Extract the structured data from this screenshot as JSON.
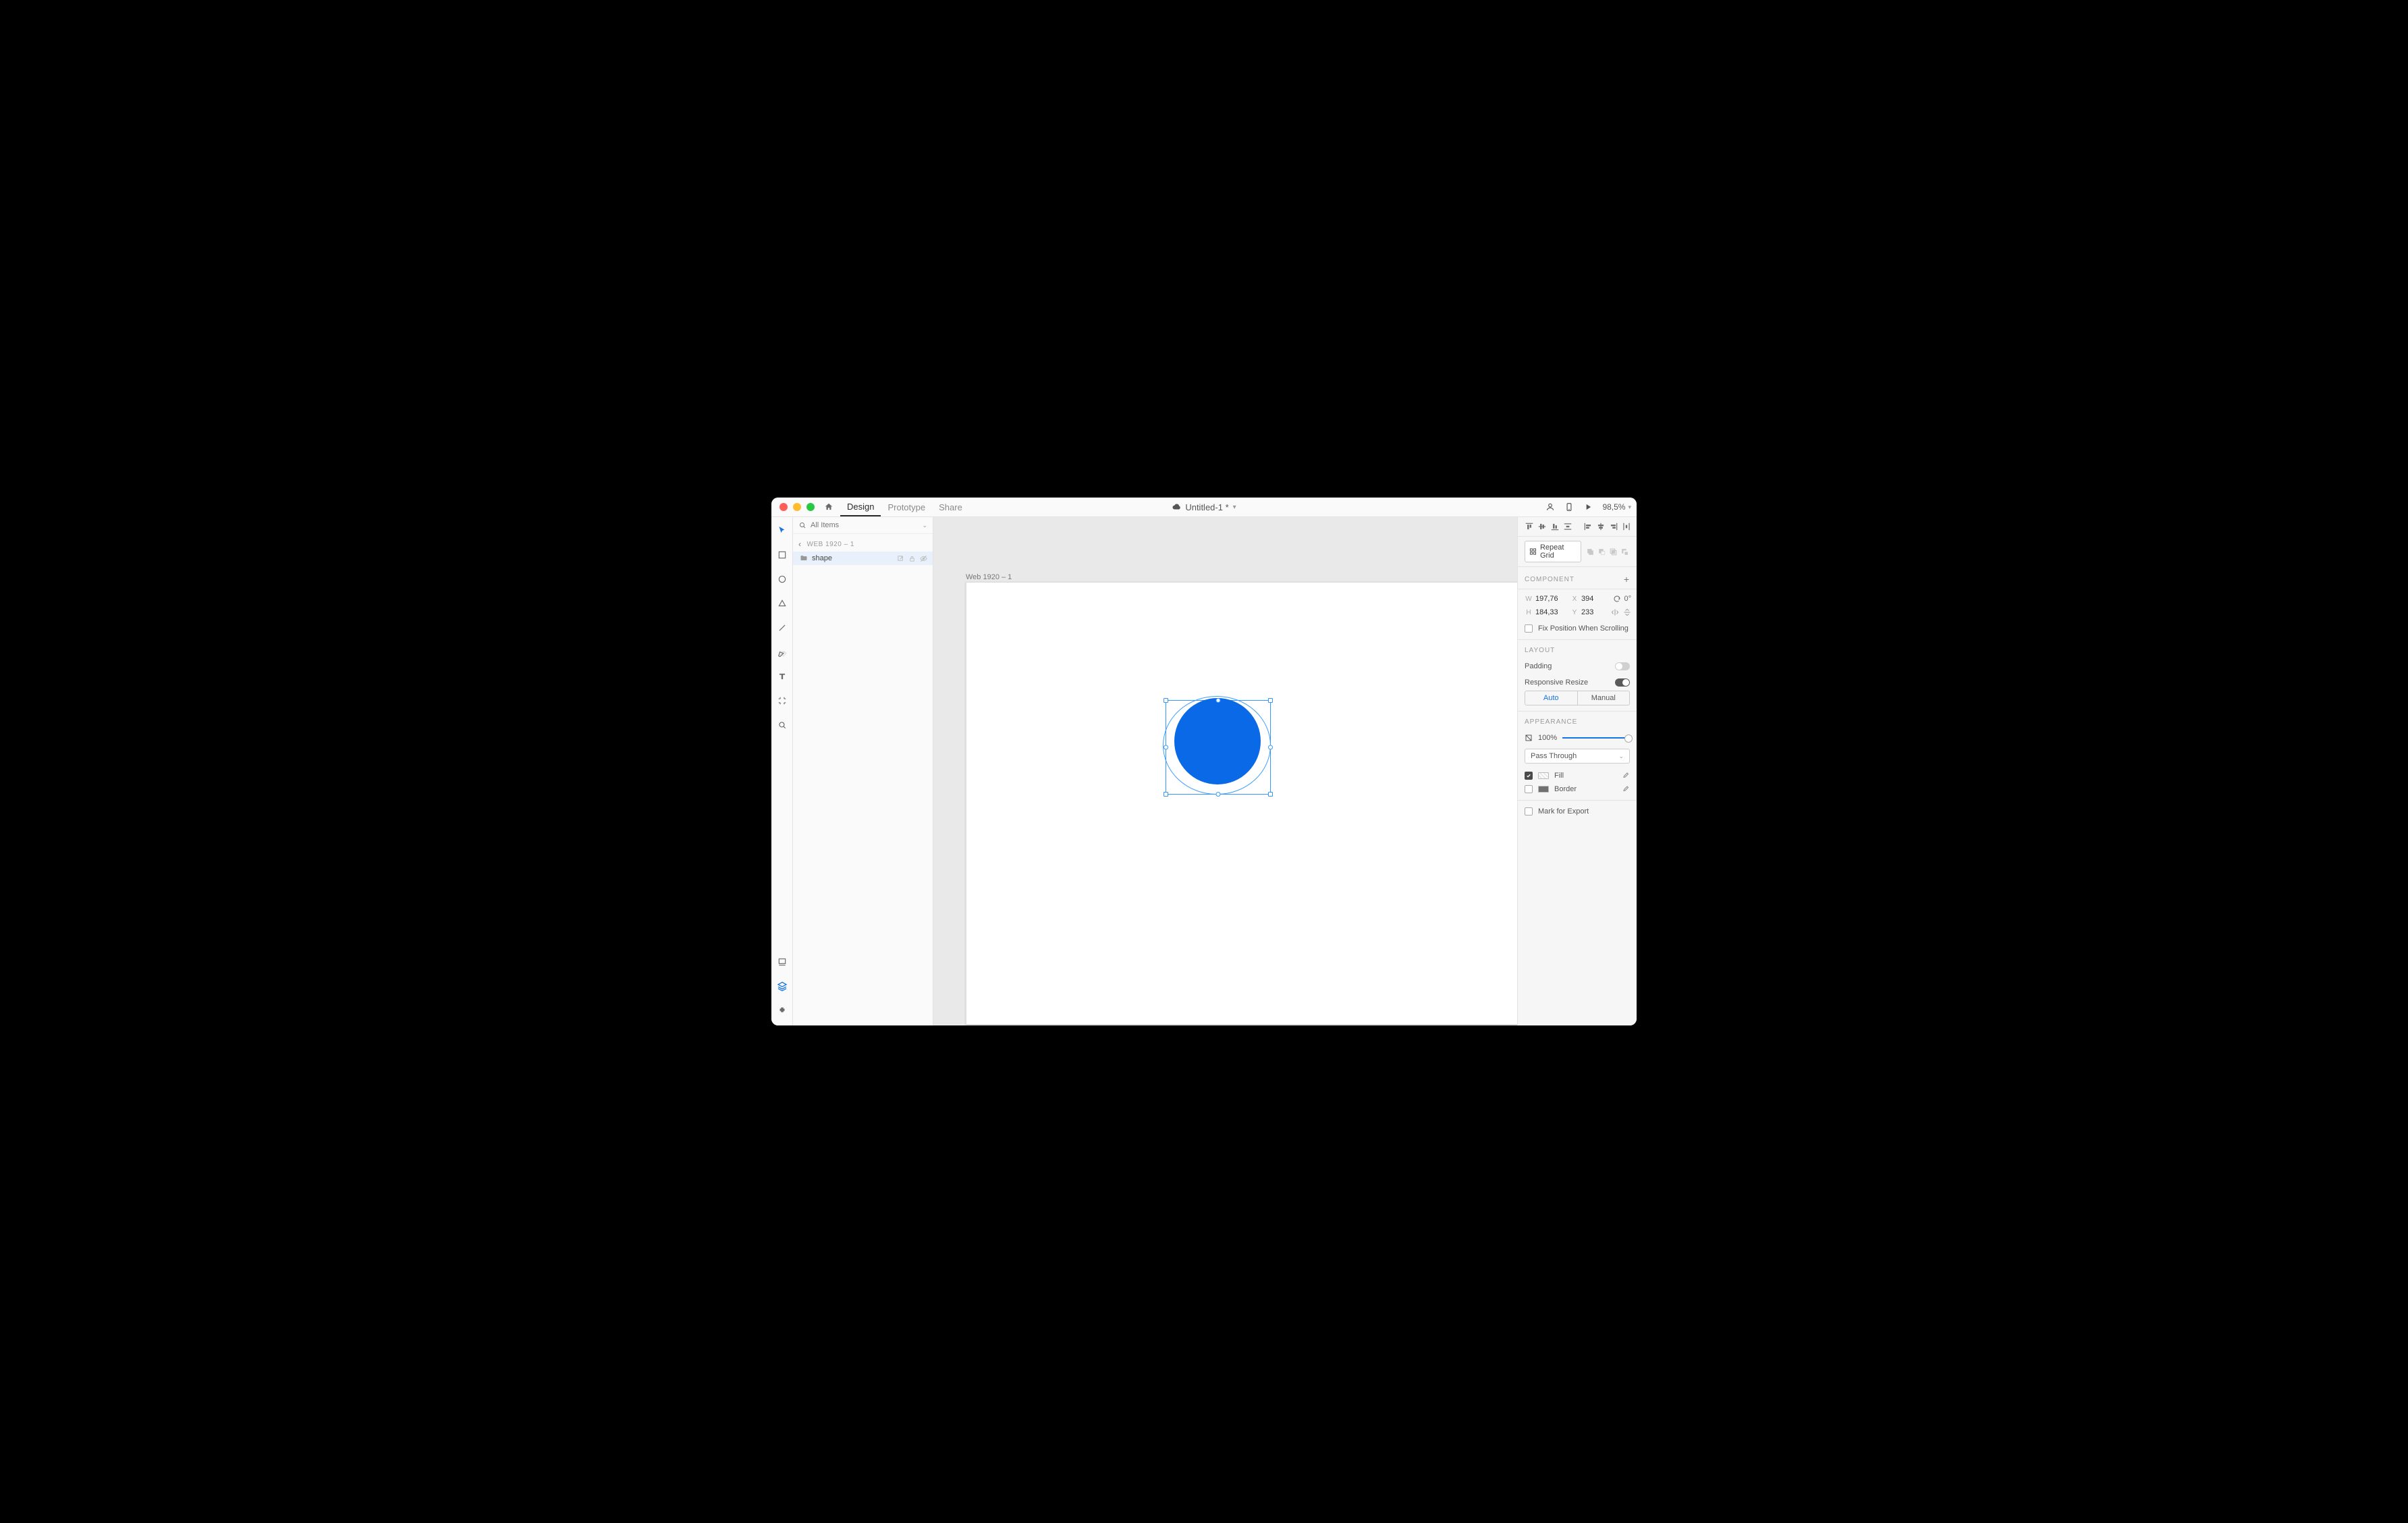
{
  "titlebar": {
    "tabs": {
      "design": "Design",
      "prototype": "Prototype",
      "share": "Share"
    },
    "document": "Untitled-1 *",
    "zoom": "98,5%"
  },
  "layers": {
    "search_placeholder": "All Items",
    "breadcrumb": "WEB 1920 – 1",
    "item": "shape"
  },
  "canvas": {
    "artboard_label": "Web 1920 – 1"
  },
  "props": {
    "repeat_grid": "Repeat Grid",
    "section_component": "COMPONENT",
    "dims": {
      "w_label": "W",
      "w_value": "197,76",
      "x_label": "X",
      "x_value": "394",
      "h_label": "H",
      "h_value": "184,33",
      "y_label": "Y",
      "y_value": "233",
      "rotation": "0°"
    },
    "fix_scroll": "Fix Position When Scrolling",
    "section_layout": "LAYOUT",
    "padding": "Padding",
    "responsive": "Responsive Resize",
    "seg_auto": "Auto",
    "seg_manual": "Manual",
    "section_appearance": "APPEARANCE",
    "opacity": "100%",
    "blend": "Pass Through",
    "fill": "Fill",
    "border": "Border",
    "mark_export": "Mark for Export"
  }
}
